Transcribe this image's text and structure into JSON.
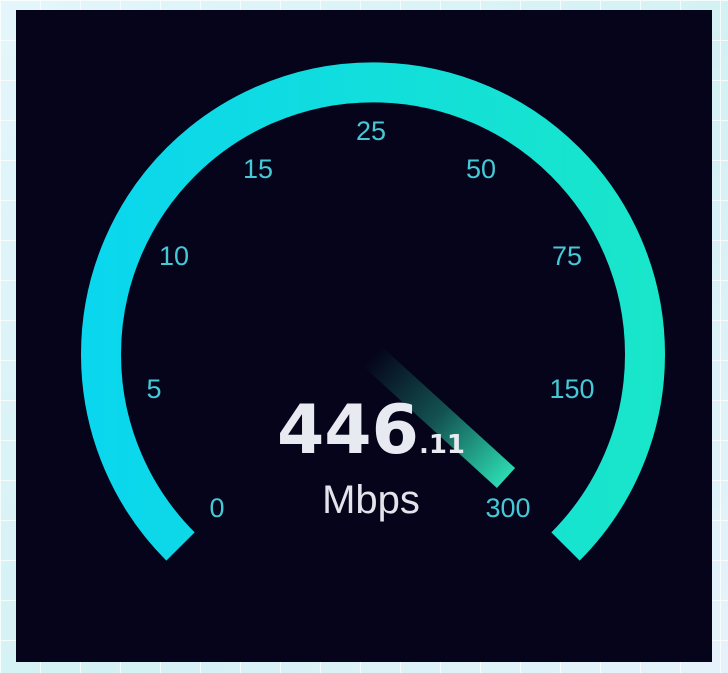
{
  "gauge": {
    "scale_labels": [
      "0",
      "5",
      "10",
      "15",
      "25",
      "50",
      "75",
      "150",
      "300"
    ],
    "reading_integer": "446",
    "reading_decimal": ".11",
    "unit": "Mbps",
    "colors": {
      "background": "#05041a",
      "arc_start": "#0ad6ef",
      "arc_end": "#19e6c9",
      "tick_label": "#46c9d7",
      "needle": "#2ee5b8",
      "readout": "#e8eaf1"
    }
  }
}
